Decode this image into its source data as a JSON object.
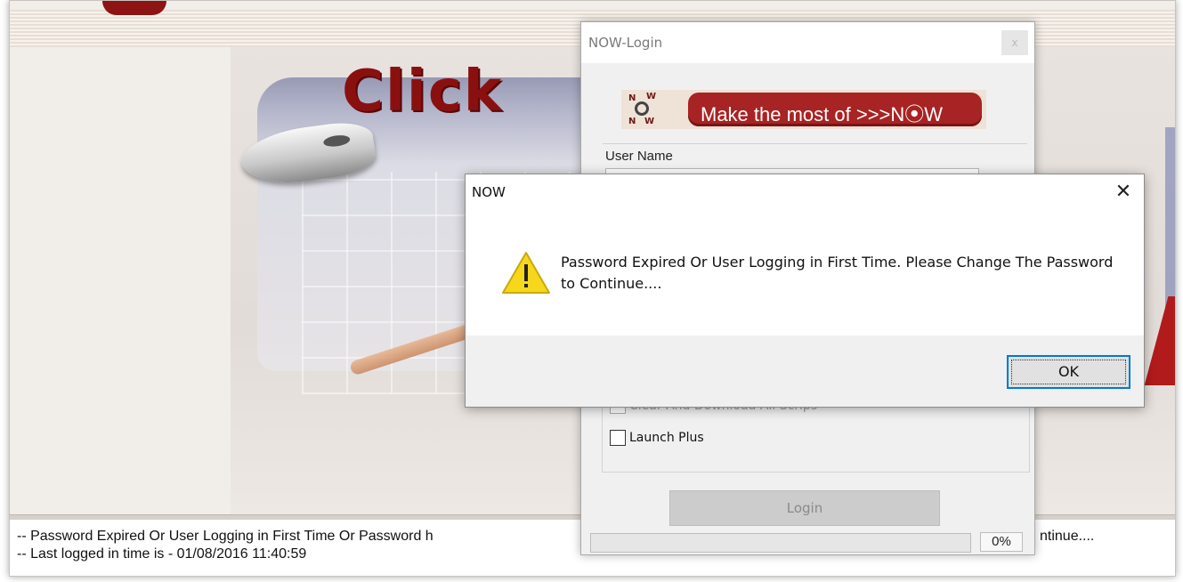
{
  "app": {
    "banner_title": "Click",
    "status": {
      "line1": "--  Password Expired Or User Logging in First Time Or Password h",
      "line1_tail": "ntinue....",
      "line2": "-- Last logged in time is - 01/08/2016 11:40:59"
    }
  },
  "login_window": {
    "title": "NOW-Login",
    "close_glyph": "x",
    "logo_letters": {
      "n": "N",
      "w": "W"
    },
    "tagline": "Make the most of >>>N⦿W",
    "username_label": "User Name",
    "options": {
      "clear_download": "Clear And Download All Scrips",
      "launch_plus": "Launch Plus"
    },
    "login_button": "Login",
    "progress_percent": 0,
    "progress_text": "0%"
  },
  "alert_dialog": {
    "title": "NOW",
    "close_glyph": "✕",
    "icon": "warning-icon",
    "message": "Password Expired Or User Logging in First Time. Please Change The Password to Continue....",
    "ok_label": "OK",
    "warning_color": "#f7d71b"
  }
}
